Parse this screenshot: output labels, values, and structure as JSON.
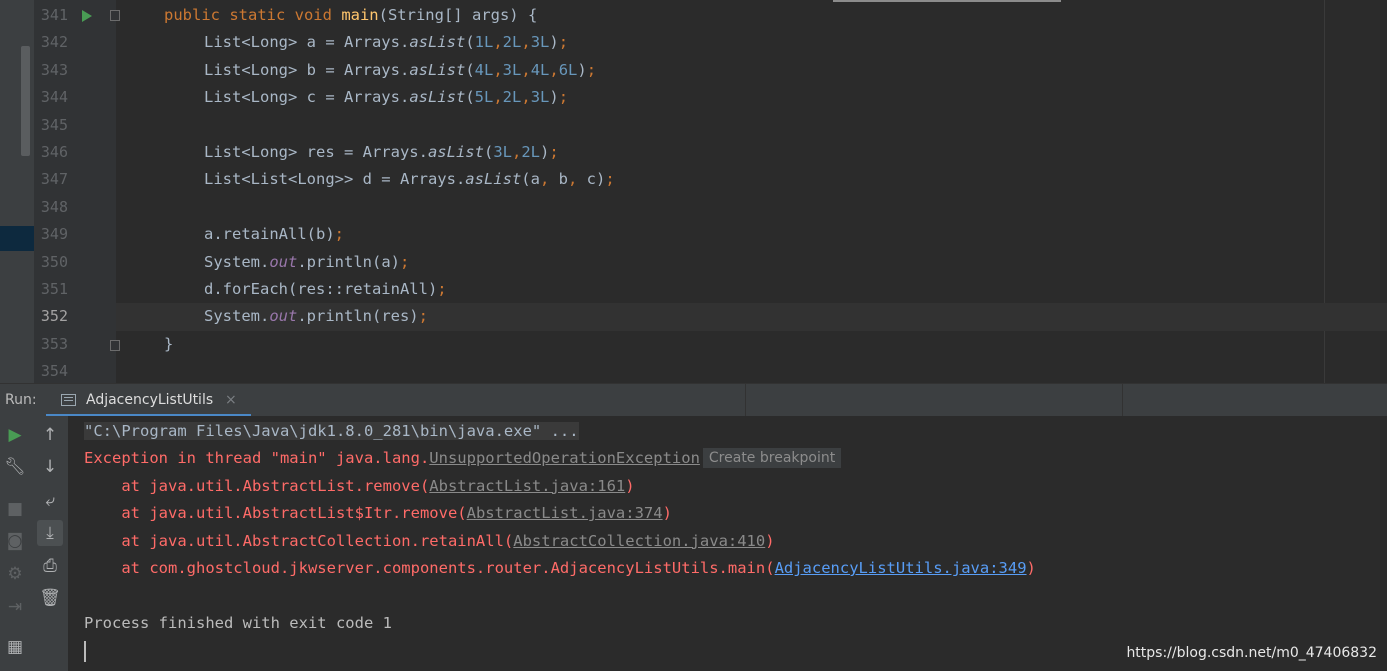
{
  "editor": {
    "lines": [
      {
        "num": "341",
        "text": "public static void main(String[] args) {"
      },
      {
        "num": "342",
        "text": "List<Long> a = Arrays.asList(1L,2L,3L);"
      },
      {
        "num": "343",
        "text": "List<Long> b = Arrays.asList(4L,3L,4L,6L);"
      },
      {
        "num": "344",
        "text": "List<Long> c = Arrays.asList(5L,2L,3L);"
      },
      {
        "num": "345",
        "text": ""
      },
      {
        "num": "346",
        "text": "List<Long> res = Arrays.asList(3L,2L);"
      },
      {
        "num": "347",
        "text": "List<List<Long>> d = Arrays.asList(a, b, c);"
      },
      {
        "num": "348",
        "text": ""
      },
      {
        "num": "349",
        "text": "a.retainAll(b);"
      },
      {
        "num": "350",
        "text": "System.out.println(a);"
      },
      {
        "num": "351",
        "text": "d.forEach(res::retainAll);"
      },
      {
        "num": "352",
        "text": "System.out.println(res);"
      },
      {
        "num": "353",
        "text": "}"
      },
      {
        "num": "354",
        "text": ""
      }
    ],
    "current_line": "352"
  },
  "run_panel": {
    "label": "Run:",
    "tab_title": "AdjacencyListUtils",
    "tab_close": "×"
  },
  "console": {
    "command": "\"C:\\Program Files\\Java\\jdk1.8.0_281\\bin\\java.exe\" ...",
    "exception_prefix": "Exception in thread \"main\" java.lang.",
    "exception_class": "UnsupportedOperationException",
    "breakpoint_hint": "Create breakpoint",
    "stack": [
      {
        "prefix": "    at java.util.AbstractList.remove(",
        "link": "AbstractList.java:161",
        "suffix": ")"
      },
      {
        "prefix": "    at java.util.AbstractList$Itr.remove(",
        "link": "AbstractList.java:374",
        "suffix": ")"
      },
      {
        "prefix": "    at java.util.AbstractCollection.retainAll(",
        "link": "AbstractCollection.java:410",
        "suffix": ")"
      },
      {
        "prefix": "    at com.ghostcloud.jkwserver.components.router.AdjacencyListUtils.main(",
        "link": "AdjacencyListUtils.java:349",
        "suffix": ")"
      }
    ],
    "finish": "Process finished with exit code 1"
  },
  "watermark": "https://blog.csdn.net/m0_47406832",
  "colors": {
    "editor_bg": "#2b2b2b",
    "keyword": "#cc7832",
    "method_decl": "#ffc66d",
    "number": "#6897bb",
    "static_field": "#9876aa",
    "error_text": "#ff6b68",
    "link": "#589df6",
    "tab_underline": "#4a88c7",
    "run_arrow": "#499c54"
  },
  "icons": {
    "toolbar": [
      "rerun-icon",
      "up-arrow-icon",
      "wrench-icon",
      "down-arrow-icon",
      "stop-icon",
      "soft-wrap-icon",
      "camera-icon",
      "scroll-to-end-icon",
      "settings-icon",
      "print-icon",
      "exit-icon",
      "trash-icon",
      "layout-icon"
    ]
  }
}
